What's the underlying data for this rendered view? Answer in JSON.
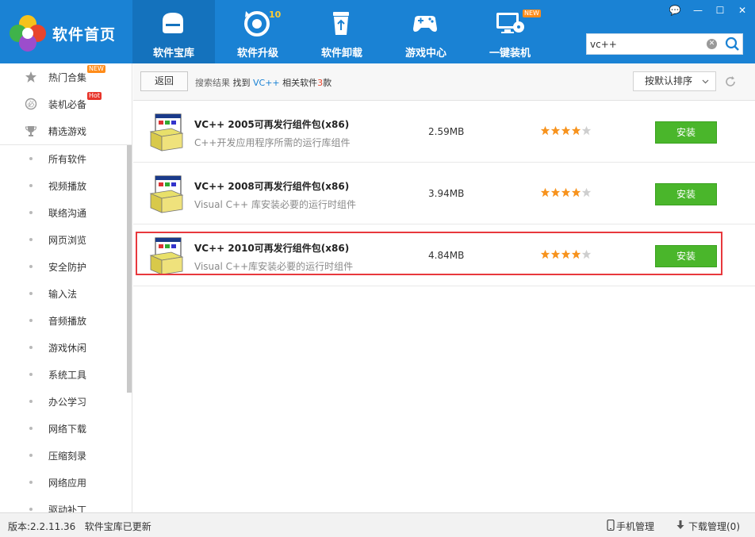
{
  "app": {
    "logo_text": "软件首页"
  },
  "nav": {
    "tabs": [
      {
        "label": "软件宝库",
        "icon": "box-icon",
        "active": true
      },
      {
        "label": "软件升级",
        "icon": "upgrade-icon",
        "badge": "10"
      },
      {
        "label": "软件卸载",
        "icon": "recycle-bin-icon"
      },
      {
        "label": "游戏中心",
        "icon": "gamepad-icon"
      },
      {
        "label": "一键装机",
        "icon": "computer-disc-icon",
        "badge": "NEW"
      }
    ]
  },
  "search": {
    "value": "vc++",
    "clear_glyph": "✕"
  },
  "window_controls": {
    "feedback": "💬",
    "minimize_glyph": "—",
    "restore_glyph": "☐",
    "close_glyph": "✕"
  },
  "sidebar": {
    "hot": [
      {
        "label": "热门合集",
        "icon": "star-icon",
        "tag": "NEW"
      },
      {
        "label": "装机必备",
        "icon": "must-have-icon",
        "tag": "Hot"
      },
      {
        "label": "精选游戏",
        "icon": "trophy-icon"
      }
    ],
    "categories": [
      "所有软件",
      "视频播放",
      "联络沟通",
      "网页浏览",
      "安全防护",
      "输入法",
      "音频播放",
      "游戏休闲",
      "系统工具",
      "办公学习",
      "网络下载",
      "压缩刻录",
      "网络应用",
      "驱动补丁"
    ]
  },
  "toolbar": {
    "back_label": "返回",
    "result_prefix": "搜索结果",
    "result_found": "找到",
    "result_keyword": "VC++",
    "result_middle": "相关软件",
    "result_count": "3",
    "result_unit": "款",
    "sort_label": "按默认排序"
  },
  "results": [
    {
      "name": "VC++ 2005可再发行组件包(x86)",
      "desc": "C++开发应用程序所需的运行库组件",
      "size": "2.59MB",
      "rating": 4,
      "max_rating": 5,
      "install_label": "安装"
    },
    {
      "name": "VC++ 2008可再发行组件包(x86)",
      "desc": "Visual C++ 库安装必要的运行时组件",
      "size": "3.94MB",
      "rating": 4,
      "max_rating": 5,
      "install_label": "安装"
    },
    {
      "name": "VC++ 2010可再发行组件包(x86)",
      "desc": "Visual C++库安装必要的运行时组件",
      "size": "4.84MB",
      "rating": 4,
      "max_rating": 5,
      "install_label": "安装"
    }
  ],
  "status": {
    "version_text": "版本:2.2.11.36",
    "update_text": "软件宝库已更新",
    "phone_label": "手机管理",
    "download_label": "下载管理(0)"
  },
  "colors": {
    "header": "#1a82d4",
    "active_tab": "#1472bd",
    "install_green": "#4ab62b",
    "star_orange": "#f7931e",
    "highlight_red": "#e8383d"
  }
}
